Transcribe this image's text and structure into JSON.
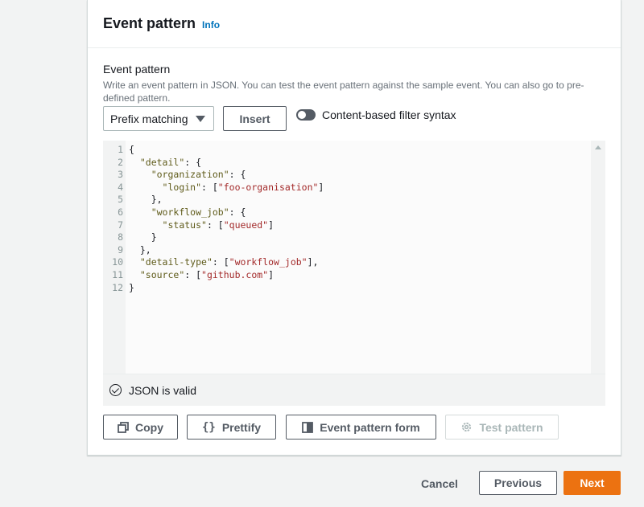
{
  "panel": {
    "title": "Event pattern",
    "info_link": "Info"
  },
  "event_pattern": {
    "label": "Event pattern",
    "description": "Write an event pattern in JSON. You can test the event pattern against the sample event. You can also go to pre-defined pattern.",
    "matching_select": {
      "selected": "Prefix matching"
    },
    "insert_label": "Insert",
    "toggle": {
      "label": "Content-based filter syntax",
      "enabled": false
    }
  },
  "editor": {
    "lines": [
      {
        "n": "1",
        "tokens": [
          {
            "t": "p",
            "v": "{"
          }
        ]
      },
      {
        "n": "2",
        "tokens": [
          {
            "t": "p",
            "v": "  "
          },
          {
            "t": "k",
            "v": "\"detail\""
          },
          {
            "t": "p",
            "v": ": {"
          }
        ]
      },
      {
        "n": "3",
        "tokens": [
          {
            "t": "p",
            "v": "    "
          },
          {
            "t": "k",
            "v": "\"organization\""
          },
          {
            "t": "p",
            "v": ": {"
          }
        ]
      },
      {
        "n": "4",
        "tokens": [
          {
            "t": "p",
            "v": "      "
          },
          {
            "t": "k",
            "v": "\"login\""
          },
          {
            "t": "p",
            "v": ": ["
          },
          {
            "t": "s",
            "v": "\"foo-organisation\""
          },
          {
            "t": "p",
            "v": "]"
          }
        ]
      },
      {
        "n": "5",
        "tokens": [
          {
            "t": "p",
            "v": "    },"
          }
        ]
      },
      {
        "n": "6",
        "tokens": [
          {
            "t": "p",
            "v": "    "
          },
          {
            "t": "k",
            "v": "\"workflow_job\""
          },
          {
            "t": "p",
            "v": ": {"
          }
        ]
      },
      {
        "n": "7",
        "tokens": [
          {
            "t": "p",
            "v": "      "
          },
          {
            "t": "k",
            "v": "\"status\""
          },
          {
            "t": "p",
            "v": ": ["
          },
          {
            "t": "s",
            "v": "\"queued\""
          },
          {
            "t": "p",
            "v": "]"
          }
        ]
      },
      {
        "n": "8",
        "tokens": [
          {
            "t": "p",
            "v": "    }"
          }
        ]
      },
      {
        "n": "9",
        "tokens": [
          {
            "t": "p",
            "v": "  },"
          }
        ]
      },
      {
        "n": "10",
        "tokens": [
          {
            "t": "p",
            "v": "  "
          },
          {
            "t": "k",
            "v": "\"detail-type\""
          },
          {
            "t": "p",
            "v": ": ["
          },
          {
            "t": "s",
            "v": "\"workflow_job\""
          },
          {
            "t": "p",
            "v": "],"
          }
        ]
      },
      {
        "n": "11",
        "tokens": [
          {
            "t": "p",
            "v": "  "
          },
          {
            "t": "k",
            "v": "\"source\""
          },
          {
            "t": "p",
            "v": ": ["
          },
          {
            "t": "s",
            "v": "\"github.com\""
          },
          {
            "t": "p",
            "v": "]"
          }
        ]
      },
      {
        "n": "12",
        "tokens": [
          {
            "t": "p",
            "v": "}"
          }
        ]
      }
    ],
    "status": "JSON is valid"
  },
  "actions": {
    "copy": "Copy",
    "prettify": "Prettify",
    "event_pattern_form": "Event pattern form",
    "test_pattern": "Test pattern"
  },
  "footer": {
    "cancel": "Cancel",
    "previous": "Previous",
    "next": "Next"
  },
  "colors": {
    "accent": "#ec7211",
    "link": "#0073bb",
    "json_key": "#5f5b1a",
    "json_string": "#a32a2a"
  },
  "icons": {
    "status": "check-circle-icon",
    "copy": "copy-icon",
    "prettify": "braces-icon",
    "form": "form-icon",
    "test": "gear-icon",
    "select": "caret-down-icon"
  }
}
